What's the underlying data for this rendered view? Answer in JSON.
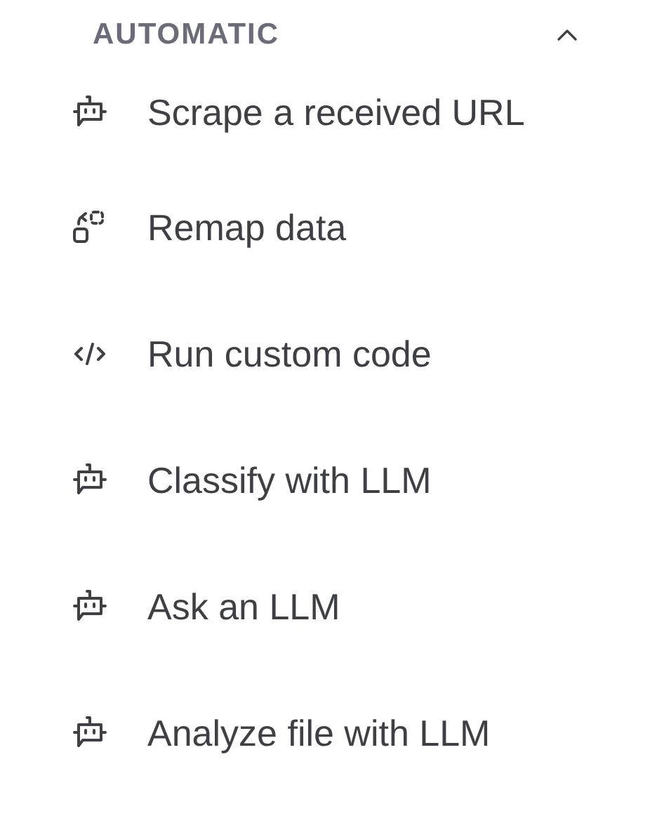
{
  "section": {
    "title": "AUTOMATIC",
    "expanded": true
  },
  "items": [
    {
      "kind": "bot",
      "label": "Scrape a received URL"
    },
    {
      "kind": "remap",
      "label": "Remap data"
    },
    {
      "kind": "code",
      "label": "Run custom code"
    },
    {
      "kind": "bot",
      "label": "Classify with LLM"
    },
    {
      "kind": "bot",
      "label": "Ask an LLM"
    },
    {
      "kind": "bot",
      "label": "Analyze file with LLM"
    }
  ]
}
